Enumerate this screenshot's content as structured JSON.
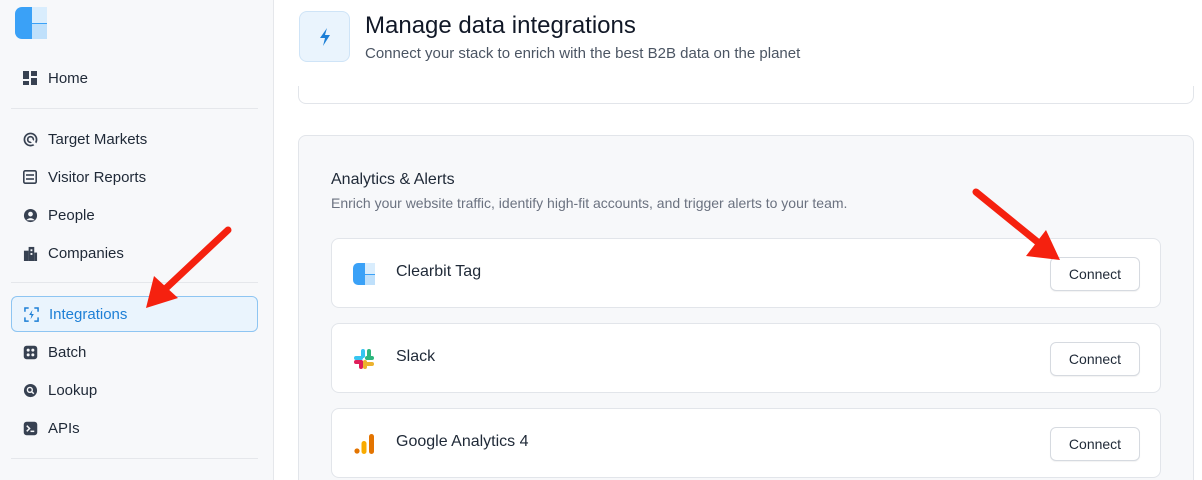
{
  "sidebar": {
    "items": [
      {
        "label": "Home",
        "icon": "dashboard-icon"
      },
      {
        "label": "Target Markets",
        "icon": "target-icon"
      },
      {
        "label": "Visitor Reports",
        "icon": "report-icon"
      },
      {
        "label": "People",
        "icon": "people-icon"
      },
      {
        "label": "Companies",
        "icon": "building-icon"
      },
      {
        "label": "Integrations",
        "icon": "integrations-icon",
        "active": true
      },
      {
        "label": "Batch",
        "icon": "batch-icon"
      },
      {
        "label": "Lookup",
        "icon": "lookup-icon"
      },
      {
        "label": "APIs",
        "icon": "terminal-icon"
      }
    ]
  },
  "header": {
    "title": "Manage data integrations",
    "subtitle": "Connect your stack to enrich with the best B2B data on the planet",
    "icon": "lightning-icon"
  },
  "section": {
    "title": "Analytics & Alerts",
    "description": "Enrich your website traffic, identify high-fit accounts, and trigger alerts to your team."
  },
  "integrations": [
    {
      "name": "Clearbit Tag",
      "button": "Connect",
      "icon": "clearbit-logo"
    },
    {
      "name": "Slack",
      "button": "Connect",
      "icon": "slack-logo"
    },
    {
      "name": "Google Analytics 4",
      "button": "Connect",
      "icon": "google-analytics-logo"
    }
  ],
  "colors": {
    "accent": "#1d7fd6",
    "annotation_arrow": "#f5210f"
  }
}
